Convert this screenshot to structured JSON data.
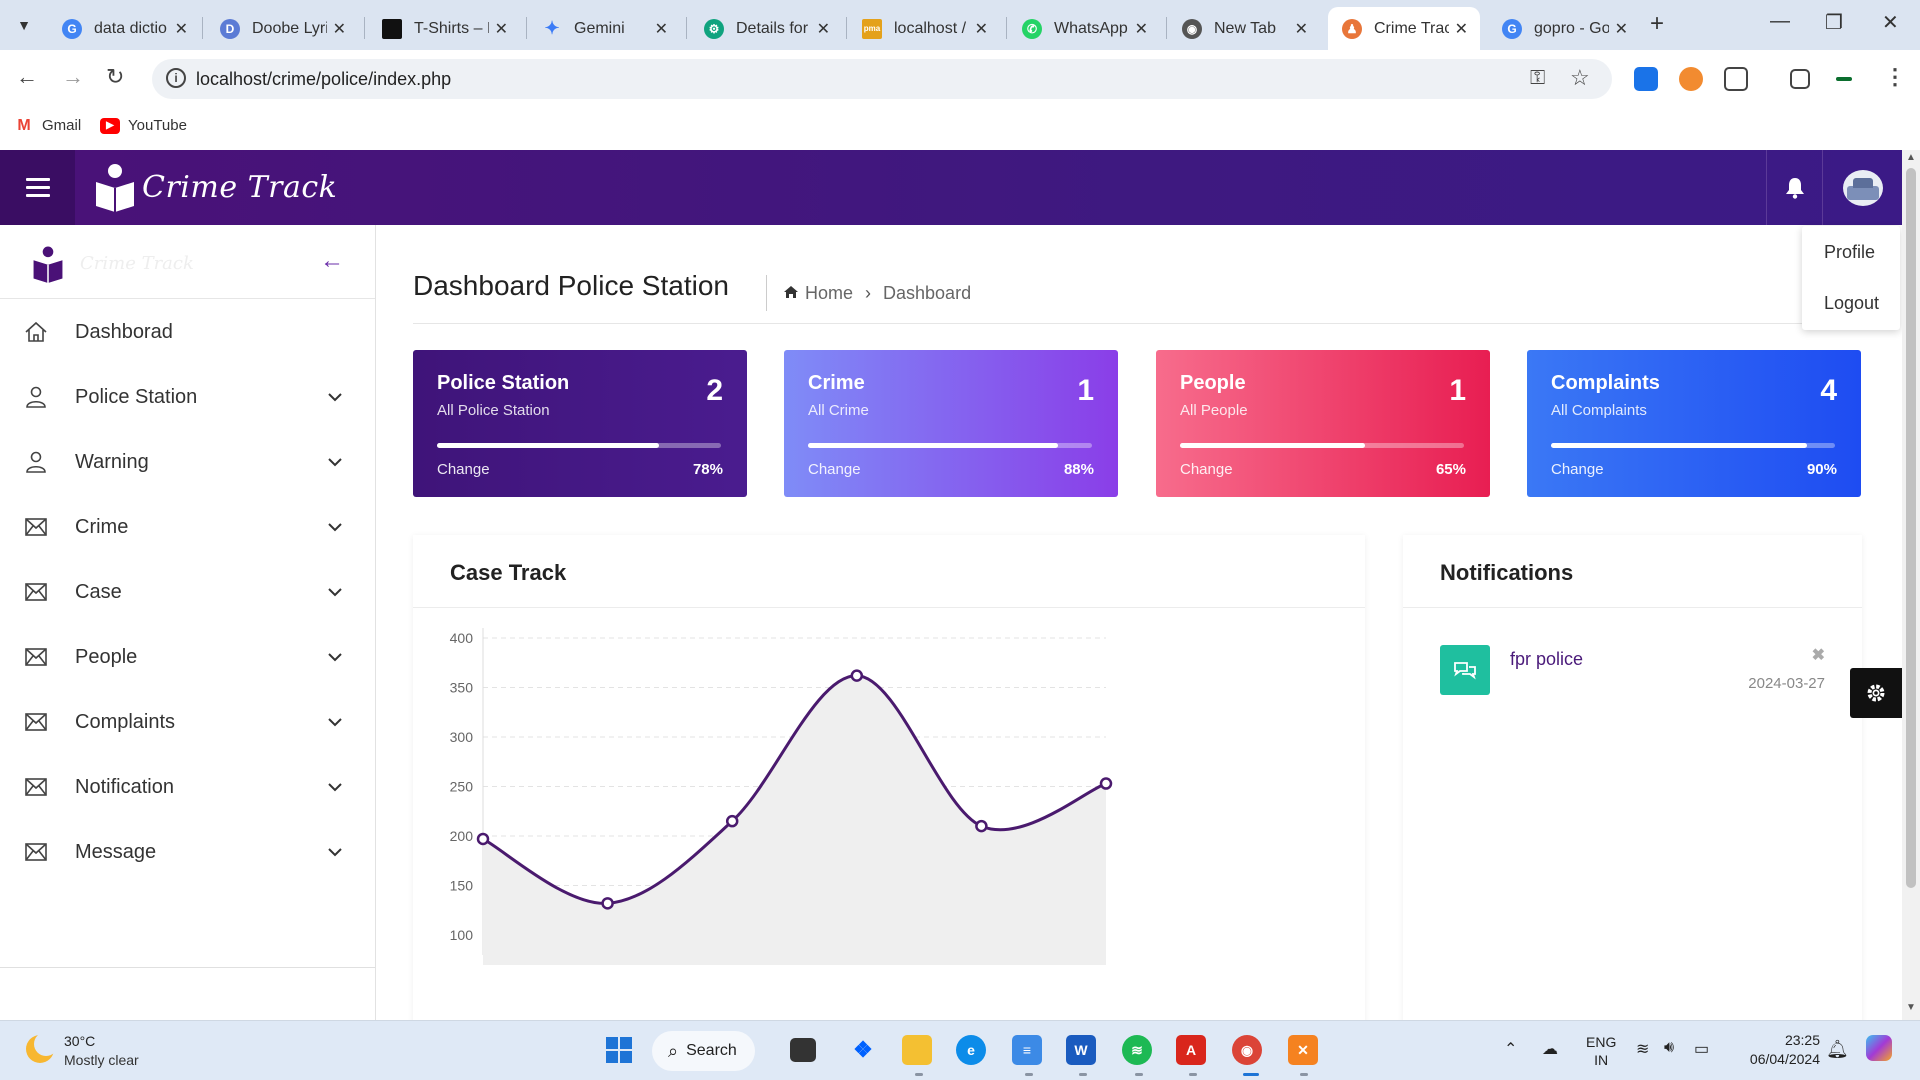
{
  "browser": {
    "tabs": [
      {
        "title": "data dictio",
        "icon": "google-icon",
        "color": "#4285f4"
      },
      {
        "title": "Doobe Lyri",
        "icon": "doobe-icon",
        "color": "#5b7bd5"
      },
      {
        "title": "T-Shirts – I",
        "icon": "tshirt-site-icon",
        "color": "#111111"
      },
      {
        "title": "Gemini",
        "icon": "gemini-icon",
        "color": "#3b7bf6"
      },
      {
        "title": "Details for",
        "icon": "chatgpt-icon",
        "color": "#10a37f"
      },
      {
        "title": "localhost /",
        "icon": "phpmyadmin-icon",
        "color": "#e4a11b"
      },
      {
        "title": "WhatsApp",
        "icon": "whatsapp-icon",
        "color": "#25d366"
      },
      {
        "title": "New Tab",
        "icon": "chrome-icon",
        "color": "#555555"
      },
      {
        "title": "Crime Trac",
        "icon": "crime-track-icon",
        "color": "#e8763a"
      },
      {
        "title": "gopro - Go",
        "icon": "google-icon",
        "color": "#4285f4"
      }
    ],
    "active_tab": 8,
    "url": "localhost/crime/police/index.php",
    "bookmarks": [
      {
        "label": "Gmail",
        "icon": "gmail-icon"
      },
      {
        "label": "YouTube",
        "icon": "youtube-icon"
      }
    ]
  },
  "app": {
    "brand": "Crime Track",
    "user_menu": {
      "profile": "Profile",
      "logout": "Logout"
    },
    "sidebar": {
      "items": [
        {
          "label": "Dashborad",
          "icon": "home-icon",
          "has_children": false
        },
        {
          "label": "Police Station",
          "icon": "user-icon",
          "has_children": true
        },
        {
          "label": "Warning",
          "icon": "user-icon",
          "has_children": true
        },
        {
          "label": "Crime",
          "icon": "envelope-icon",
          "has_children": true
        },
        {
          "label": "Case",
          "icon": "envelope-icon",
          "has_children": true
        },
        {
          "label": "People",
          "icon": "envelope-icon",
          "has_children": true
        },
        {
          "label": "Complaints",
          "icon": "envelope-icon",
          "has_children": true
        },
        {
          "label": "Notification",
          "icon": "envelope-icon",
          "has_children": true
        },
        {
          "label": "Message",
          "icon": "envelope-icon",
          "has_children": true
        }
      ]
    },
    "page_title": "Dashboard Police Station",
    "breadcrumb": {
      "home": "Home",
      "current": "Dashboard"
    },
    "cards": [
      {
        "title": "Police Station",
        "subtitle": "All Police Station",
        "count": "2",
        "change_label": "Change",
        "percent_label": "78%",
        "progress": 0.78,
        "gradient": [
          "#3f1479",
          "#4a1c8f"
        ]
      },
      {
        "title": "Crime",
        "subtitle": "All Crime",
        "count": "1",
        "change_label": "Change",
        "percent_label": "88%",
        "progress": 0.88,
        "gradient": [
          "#7f8cf7",
          "#8a3ee8"
        ]
      },
      {
        "title": "People",
        "subtitle": "All People",
        "count": "1",
        "change_label": "Change",
        "percent_label": "65%",
        "progress": 0.65,
        "gradient": [
          "#f76c8c",
          "#e81e52"
        ]
      },
      {
        "title": "Complaints",
        "subtitle": "All Complaints",
        "count": "4",
        "change_label": "Change",
        "percent_label": "90%",
        "progress": 0.9,
        "gradient": [
          "#3b78f5",
          "#1e4cf2"
        ]
      }
    ],
    "case_track": {
      "title": "Case Track"
    },
    "notifications": {
      "title": "Notifications",
      "items": [
        {
          "text": "fpr police",
          "date": "2024-03-27"
        }
      ]
    }
  },
  "chart_data": {
    "type": "area",
    "title": "Case Track",
    "y_ticks": [
      100,
      150,
      200,
      250,
      300,
      350,
      400
    ],
    "ylim": [
      100,
      400
    ],
    "grid": true,
    "series": [
      {
        "values": [
          197,
          132,
          215,
          362,
          210,
          253
        ],
        "color": "#4a1a6e",
        "fill": "#efefef"
      }
    ]
  },
  "taskbar": {
    "weather": {
      "temp": "30°C",
      "condition": "Mostly clear"
    },
    "search_label": "Search",
    "lang_top": "ENG",
    "lang_bottom": "IN",
    "time": "23:25",
    "date": "06/04/2024"
  }
}
